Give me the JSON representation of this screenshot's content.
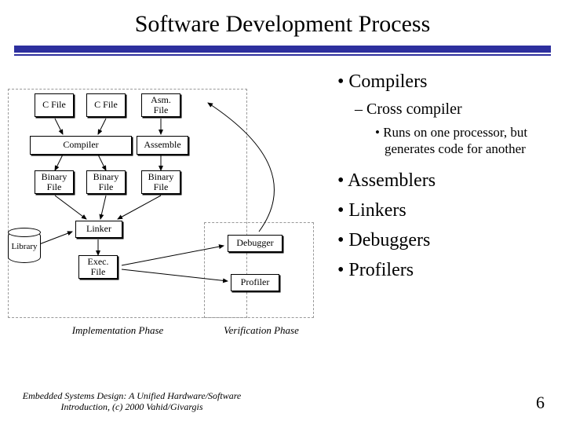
{
  "title": "Software Development Process",
  "bullets": {
    "compilers": "Compilers",
    "cross": "Cross compiler",
    "cross_detail": "Runs on one processor, but generates code for another",
    "assemblers": "Assemblers",
    "linkers": "Linkers",
    "debuggers": "Debuggers",
    "profilers": "Profilers"
  },
  "diagram": {
    "cfile1": "C File",
    "cfile2": "C File",
    "asmfile": "Asm.\nFile",
    "compiler": "Compiler",
    "assemble": "Assemble",
    "bin1": "Binary\nFile",
    "bin2": "Binary\nFile",
    "bin3": "Binary\nFile",
    "library": "Library",
    "linker": "Linker",
    "exec": "Exec.\nFile",
    "debugger": "Debugger",
    "profiler": "Profiler",
    "impl_phase": "Implementation Phase",
    "verif_phase": "Verification Phase"
  },
  "footer": "Embedded Systems Design: A Unified Hardware/Software Introduction, (c) 2000 Vahid/Givargis",
  "page": "6"
}
